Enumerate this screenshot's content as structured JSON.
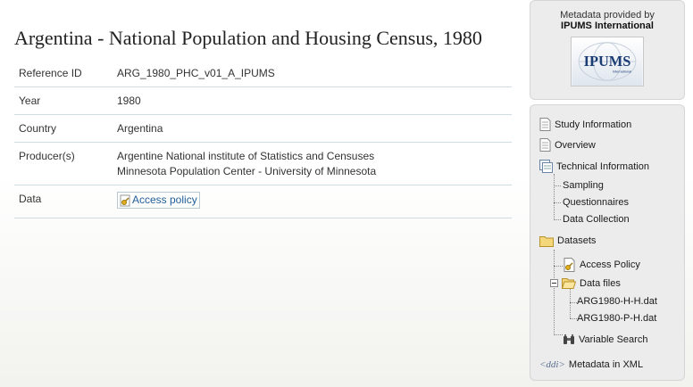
{
  "study": {
    "title": "Argentina - National Population and Housing Census, 1980"
  },
  "info_rows": [
    {
      "label": "Reference ID",
      "value": "ARG_1980_PHC_v01_A_IPUMS"
    },
    {
      "label": "Year",
      "value": "1980"
    },
    {
      "label": "Country",
      "value": "Argentina"
    },
    {
      "label": "Producer(s)",
      "value_lines": [
        "Argentine National institute of Statistics and Censuses",
        "Minnesota Population Center - University of Minnesota"
      ]
    },
    {
      "label": "Data",
      "link_label": "Access policy"
    }
  ],
  "metadata_box": {
    "line1": "Metadata provided by",
    "line2": "IPUMS International",
    "logo_text": "IPUMS",
    "logo_subtext": "International"
  },
  "nav": {
    "study_information": "Study Information",
    "overview": "Overview",
    "technical_information": "Technical Information",
    "sampling": "Sampling",
    "questionnaires": "Questionnaires",
    "data_collection": "Data Collection",
    "datasets": "Datasets",
    "access_policy": "Access Policy",
    "data_files": "Data files",
    "file_h": "ARG1980-H-H.dat",
    "file_p": "ARG1980-P-H.dat",
    "variable_search": "Variable Search",
    "metadata_xml": "Metadata in XML",
    "ddi_icon_text": "<ddi>"
  }
}
